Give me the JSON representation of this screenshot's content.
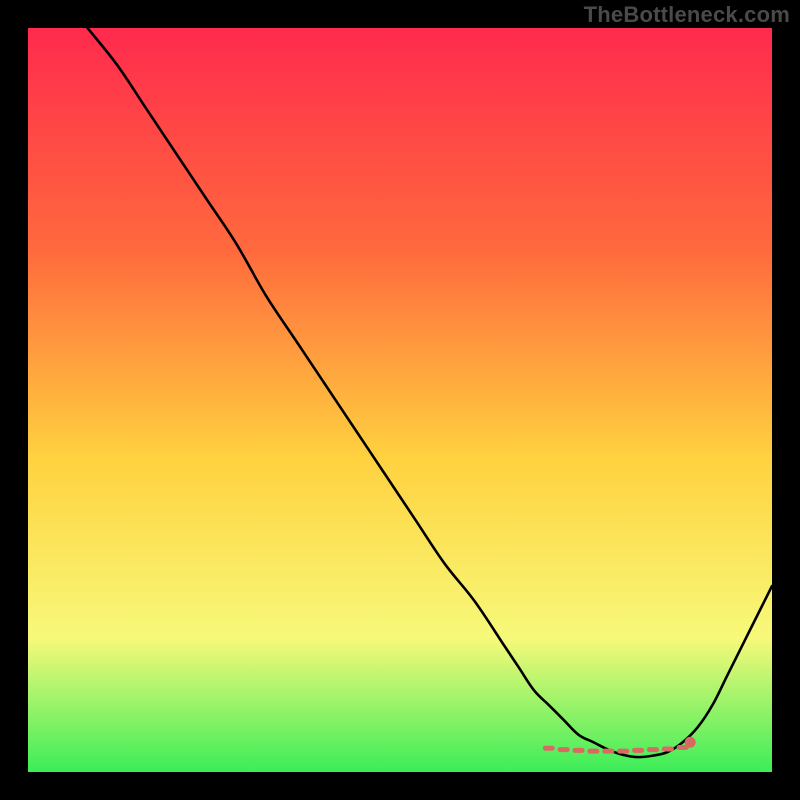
{
  "watermark": "TheBottleneck.com",
  "colors": {
    "frame": "#000000",
    "gradient_top": "#ff2a4d",
    "gradient_mid1": "#ff6a3d",
    "gradient_mid2": "#ffd23f",
    "gradient_mid3": "#f7f97a",
    "gradient_bottom": "#3bed58",
    "curve": "#000000",
    "marker_fill": "#d86a63",
    "marker_stroke": "#d86a63"
  },
  "chart_data": {
    "type": "line",
    "title": "",
    "xlabel": "",
    "ylabel": "",
    "xlim": [
      0,
      100
    ],
    "ylim": [
      0,
      100
    ],
    "grid": false,
    "legend": false,
    "series": [
      {
        "name": "bottleneck-curve",
        "x": [
          8,
          12,
          16,
          20,
          24,
          28,
          32,
          36,
          40,
          44,
          48,
          52,
          56,
          60,
          64,
          66,
          68,
          70,
          72,
          74,
          76,
          78,
          80,
          82,
          84,
          86,
          88,
          90,
          92,
          94,
          96,
          98,
          100
        ],
        "y": [
          100,
          95,
          89,
          83,
          77,
          71,
          64,
          58,
          52,
          46,
          40,
          34,
          28,
          23,
          17,
          14,
          11,
          9,
          7,
          5,
          4,
          3,
          2.3,
          2,
          2.2,
          2.7,
          4,
          6,
          9,
          13,
          17,
          21,
          25
        ]
      }
    ],
    "markers_flat": {
      "name": "optimal-range",
      "x": [
        70,
        72,
        74,
        76,
        78,
        80,
        82,
        84,
        86,
        88
      ],
      "y": [
        3.2,
        3.0,
        2.9,
        2.8,
        2.8,
        2.8,
        2.9,
        3.0,
        3.1,
        3.3
      ]
    },
    "marker_highlight": {
      "name": "selected-point",
      "x": 89,
      "y": 4.0
    }
  }
}
